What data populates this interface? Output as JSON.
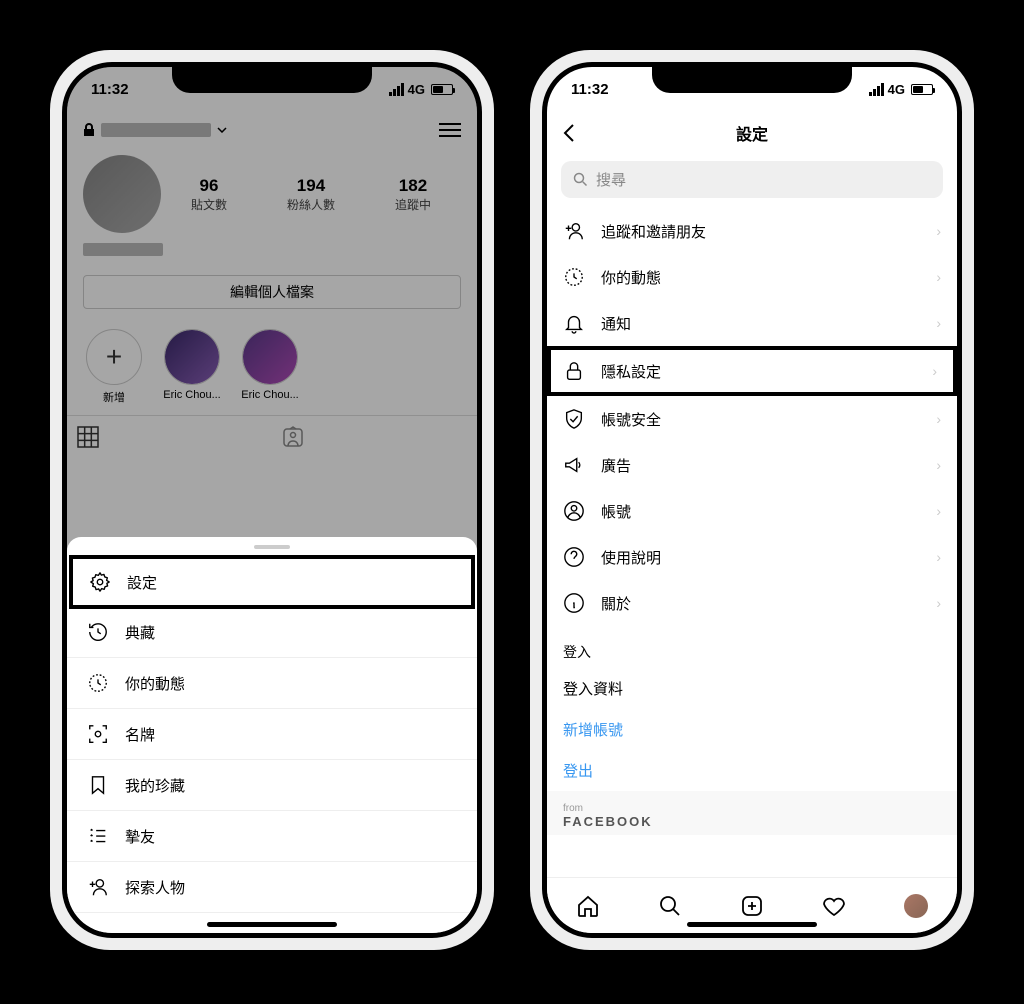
{
  "status": {
    "time": "11:32",
    "network": "4G"
  },
  "left": {
    "profile": {
      "posts_count": "96",
      "posts_label": "貼文數",
      "followers_count": "194",
      "followers_label": "粉絲人數",
      "following_count": "182",
      "following_label": "追蹤中",
      "edit_button": "編輯個人檔案",
      "highlight_add": "新增",
      "highlight_1": "Eric Chou...",
      "highlight_2": "Eric Chou..."
    },
    "menu": {
      "settings": "設定",
      "archive": "典藏",
      "activity": "你的動態",
      "nametag": "名牌",
      "saved": "我的珍藏",
      "close_friends": "摯友",
      "discover": "探索人物"
    }
  },
  "right": {
    "title": "設定",
    "search_placeholder": "搜尋",
    "items": {
      "follow_invite": "追蹤和邀請朋友",
      "activity": "你的動態",
      "notifications": "通知",
      "privacy": "隱私設定",
      "security": "帳號安全",
      "ads": "廣告",
      "account": "帳號",
      "help": "使用說明",
      "about": "關於"
    },
    "login_section": "登入",
    "login_info": "登入資料",
    "add_account": "新增帳號",
    "logout": "登出",
    "from_label": "from",
    "facebook": "FACEBOOK"
  }
}
